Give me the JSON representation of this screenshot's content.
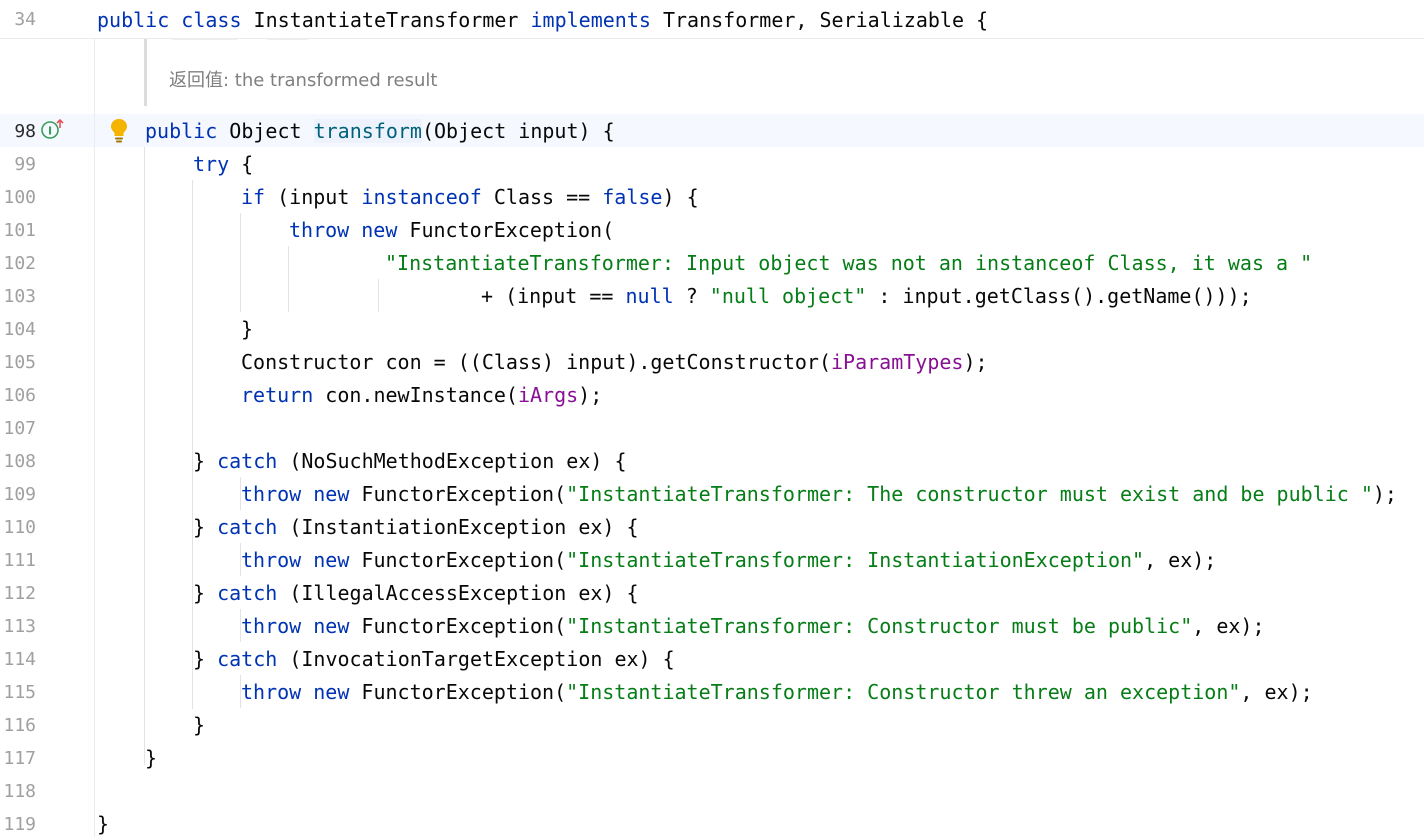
{
  "editor": {
    "sticky": {
      "line_number": "34",
      "tokens": [
        {
          "text": "public class ",
          "cls": "kw"
        },
        {
          "text": "InstantiateTransformer ",
          "cls": ""
        },
        {
          "text": "implements ",
          "cls": "kw"
        },
        {
          "text": "Transformer, Serializable {",
          "cls": ""
        }
      ]
    },
    "doc_comment": {
      "returns_text": "返回值: the transformed result"
    },
    "icons": {
      "gutter_marker": "implements-method-icon",
      "intention": "lightbulb-icon"
    },
    "colors": {
      "keyword": "#0033b3",
      "string": "#067d17",
      "field": "#871094",
      "method_declaration": "#00627a",
      "line_highlight": "#f5f8fe"
    },
    "lines": [
      {
        "number": "98",
        "indent": 1,
        "active": true,
        "tokens": [
          {
            "text": "public ",
            "cls": "kw"
          },
          {
            "text": "Object ",
            "cls": ""
          },
          {
            "text": "transform",
            "cls": "fn-decl"
          },
          {
            "text": "(Object input) {",
            "cls": ""
          }
        ]
      },
      {
        "number": "99",
        "indent": 2,
        "tokens": [
          {
            "text": "try",
            "cls": "kw"
          },
          {
            "text": " {",
            "cls": ""
          }
        ]
      },
      {
        "number": "100",
        "indent": 3,
        "tokens": [
          {
            "text": "if",
            "cls": "kw"
          },
          {
            "text": " (input ",
            "cls": ""
          },
          {
            "text": "instanceof",
            "cls": "kw"
          },
          {
            "text": " Class == ",
            "cls": ""
          },
          {
            "text": "false",
            "cls": "kw"
          },
          {
            "text": ") {",
            "cls": ""
          }
        ]
      },
      {
        "number": "101",
        "indent": 4,
        "tokens": [
          {
            "text": "throw new",
            "cls": "kw"
          },
          {
            "text": " FunctorException(",
            "cls": ""
          }
        ]
      },
      {
        "number": "102",
        "indent": 6,
        "tokens": [
          {
            "text": "\"InstantiateTransformer: Input object was not an instanceof Class, it was a \"",
            "cls": "str"
          }
        ]
      },
      {
        "number": "103",
        "indent": 8,
        "tokens": [
          {
            "text": "+ (input == ",
            "cls": ""
          },
          {
            "text": "null",
            "cls": "kw"
          },
          {
            "text": " ? ",
            "cls": ""
          },
          {
            "text": "\"null object\"",
            "cls": "str"
          },
          {
            "text": " : input.getClass().getName()));",
            "cls": ""
          }
        ]
      },
      {
        "number": "104",
        "indent": 3,
        "tokens": [
          {
            "text": "}",
            "cls": ""
          }
        ]
      },
      {
        "number": "105",
        "indent": 3,
        "tokens": [
          {
            "text": "Constructor con = ((Class) input).getConstructor(",
            "cls": ""
          },
          {
            "text": "iParamTypes",
            "cls": "fld"
          },
          {
            "text": ");",
            "cls": ""
          }
        ]
      },
      {
        "number": "106",
        "indent": 3,
        "tokens": [
          {
            "text": "return",
            "cls": "kw"
          },
          {
            "text": " con.newInstance(",
            "cls": ""
          },
          {
            "text": "iArgs",
            "cls": "fld"
          },
          {
            "text": ");",
            "cls": ""
          }
        ]
      },
      {
        "number": "107",
        "indent": 0,
        "tokens": []
      },
      {
        "number": "108",
        "indent": 2,
        "tokens": [
          {
            "text": "} ",
            "cls": ""
          },
          {
            "text": "catch",
            "cls": "kw"
          },
          {
            "text": " (NoSuchMethodException ex) {",
            "cls": ""
          }
        ]
      },
      {
        "number": "109",
        "indent": 3,
        "tokens": [
          {
            "text": "throw new",
            "cls": "kw"
          },
          {
            "text": " FunctorException(",
            "cls": ""
          },
          {
            "text": "\"InstantiateTransformer: The constructor must exist and be public \"",
            "cls": "str"
          },
          {
            "text": ");",
            "cls": ""
          }
        ]
      },
      {
        "number": "110",
        "indent": 2,
        "tokens": [
          {
            "text": "} ",
            "cls": ""
          },
          {
            "text": "catch",
            "cls": "kw"
          },
          {
            "text": " (InstantiationException ex) {",
            "cls": ""
          }
        ]
      },
      {
        "number": "111",
        "indent": 3,
        "tokens": [
          {
            "text": "throw new",
            "cls": "kw"
          },
          {
            "text": " FunctorException(",
            "cls": ""
          },
          {
            "text": "\"InstantiateTransformer: InstantiationException\"",
            "cls": "str"
          },
          {
            "text": ", ex);",
            "cls": ""
          }
        ]
      },
      {
        "number": "112",
        "indent": 2,
        "tokens": [
          {
            "text": "} ",
            "cls": ""
          },
          {
            "text": "catch",
            "cls": "kw"
          },
          {
            "text": " (IllegalAccessException ex) {",
            "cls": ""
          }
        ]
      },
      {
        "number": "113",
        "indent": 3,
        "tokens": [
          {
            "text": "throw new",
            "cls": "kw"
          },
          {
            "text": " FunctorException(",
            "cls": ""
          },
          {
            "text": "\"InstantiateTransformer: Constructor must be public\"",
            "cls": "str"
          },
          {
            "text": ", ex);",
            "cls": ""
          }
        ]
      },
      {
        "number": "114",
        "indent": 2,
        "tokens": [
          {
            "text": "} ",
            "cls": ""
          },
          {
            "text": "catch",
            "cls": "kw"
          },
          {
            "text": " (InvocationTargetException ex) {",
            "cls": ""
          }
        ]
      },
      {
        "number": "115",
        "indent": 3,
        "tokens": [
          {
            "text": "throw new",
            "cls": "kw"
          },
          {
            "text": " FunctorException(",
            "cls": ""
          },
          {
            "text": "\"InstantiateTransformer: Constructor threw an exception\"",
            "cls": "str"
          },
          {
            "text": ", ex);",
            "cls": ""
          }
        ]
      },
      {
        "number": "116",
        "indent": 2,
        "tokens": [
          {
            "text": "}",
            "cls": ""
          }
        ]
      },
      {
        "number": "117",
        "indent": 1,
        "tokens": [
          {
            "text": "}",
            "cls": ""
          }
        ]
      },
      {
        "number": "118",
        "indent": 0,
        "tokens": []
      },
      {
        "number": "119",
        "indent": 0,
        "tokens": [
          {
            "text": "}",
            "cls": ""
          }
        ]
      }
    ]
  }
}
